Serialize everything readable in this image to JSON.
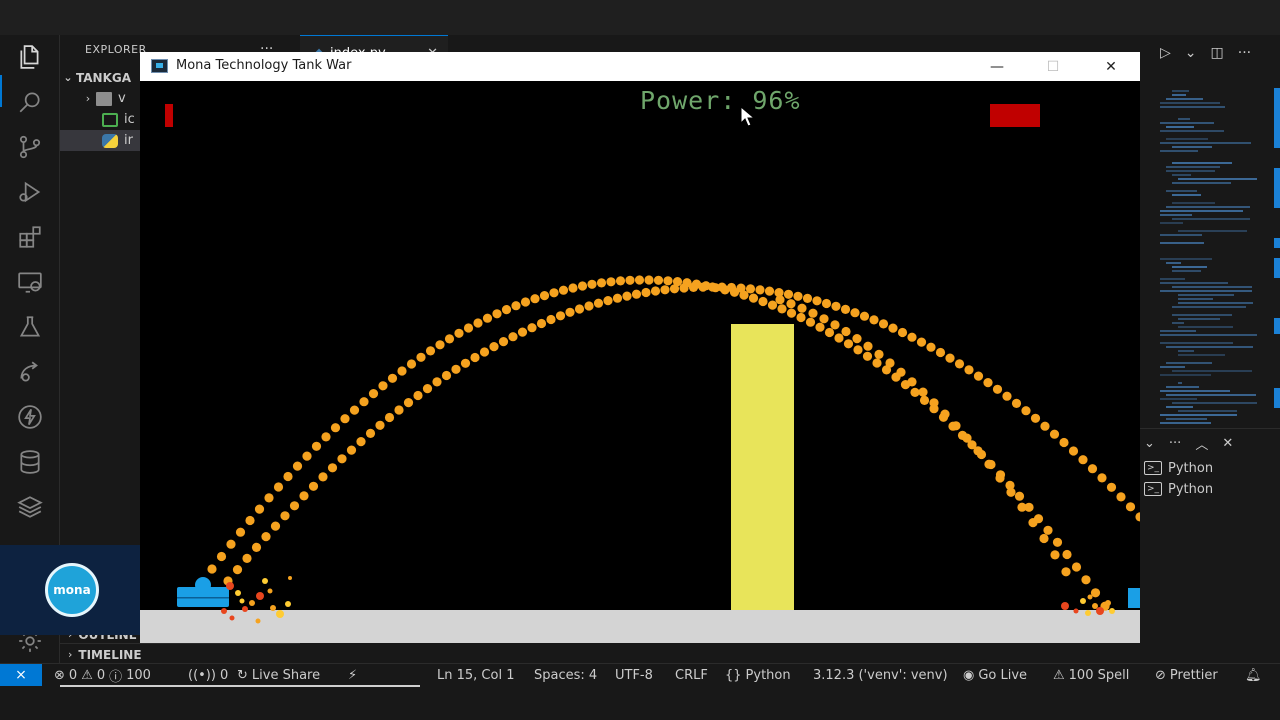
{
  "vscode": {
    "explorer_title": "EXPLORER",
    "project_name": "TANKGA",
    "folder_label": "v",
    "file1_label": "ic",
    "file2_label": "ir",
    "outline_label": "OUTLINE",
    "timeline_label": "TIMELINE",
    "editor_tab": "index.py",
    "terminals": [
      "Python",
      "Python"
    ]
  },
  "statusbar": {
    "errors": "0",
    "warnings": "0",
    "info": "100",
    "ports": "0",
    "live_share": "Live Share",
    "cursor_pos": "Ln 15, Col 1",
    "spaces": "Spaces: 4",
    "encoding": "UTF-8",
    "eol": "CRLF",
    "language": "Python",
    "interpreter": "3.12.3 ('venv': venv)",
    "go_live": "Go Live",
    "spell": "100 Spell",
    "prettier": "Prettier"
  },
  "mona_logo_text": "mona",
  "game": {
    "window_title": "Mona Technology Tank War",
    "power_label": "Power:",
    "power_value": "96%",
    "power": 96,
    "player_health": 0.1,
    "enemy_health": 1.0,
    "colors": {
      "trail": "#f5a21f",
      "wall": "#e8e45a",
      "ground": "#d4d4d4",
      "tank": "#1a9fe6",
      "health_bar": "#c00000",
      "power_text": "#6fa66b",
      "spark": "#ffcc33",
      "spark_dark": "#e8461e"
    }
  }
}
